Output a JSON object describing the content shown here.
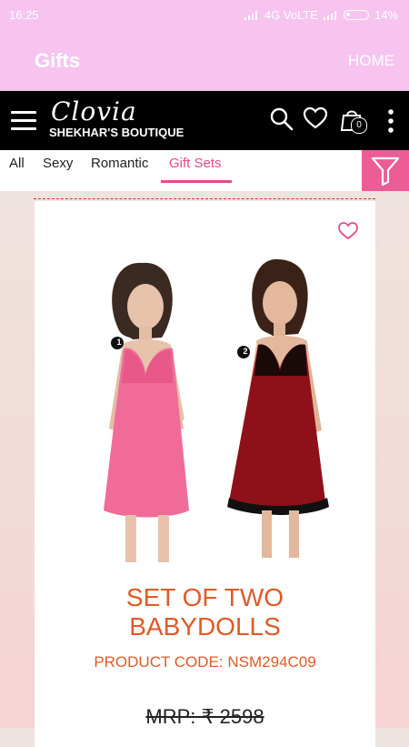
{
  "status": {
    "time": "16:25",
    "network": "4G VoLTE",
    "battery": "14%"
  },
  "appbar": {
    "title": "Gifts",
    "home": "HOME"
  },
  "header": {
    "brand": "Clovia",
    "store": "SHEKHAR'S BOUTIQUE",
    "cart_count": "0"
  },
  "tabs": [
    "All",
    "Sexy",
    "Romantic",
    "Gift Sets"
  ],
  "active_tab": "Gift Sets",
  "product": {
    "title_line1": "SET OF TWO",
    "title_line2": "BABYDOLLS",
    "code": "PRODUCT CODE: NSM294C09",
    "mrp": "MRP: ₹ 2598",
    "badge1": "1",
    "badge2": "2"
  },
  "colors": {
    "appbar": "#f7c4f0",
    "accent": "#e8498a",
    "filter": "#ec5d95",
    "title": "#e05a28",
    "header": "#000000"
  },
  "icons": [
    "hamburger-icon",
    "search-icon",
    "heart-icon",
    "cart-icon",
    "more-icon",
    "filter-icon",
    "wishlist-heart-icon"
  ]
}
